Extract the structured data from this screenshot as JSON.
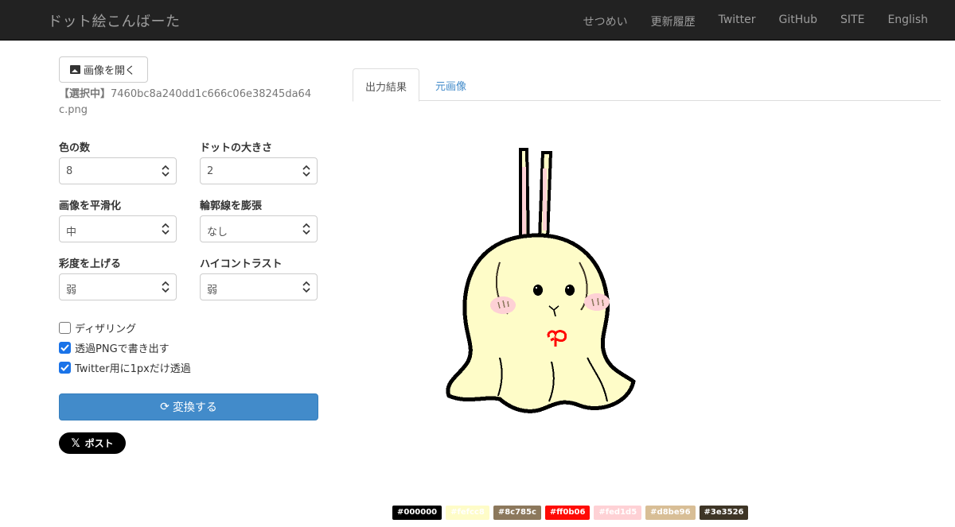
{
  "navbar": {
    "brand": "ドット絵こんばーた",
    "links": [
      "せつめい",
      "更新履歴",
      "Twitter",
      "GitHub",
      "SITE",
      "English"
    ]
  },
  "controls": {
    "open_button": "画像を開く",
    "selected_prefix": "【選択中】",
    "selected_file": "7460bc8a240dd1c666c06e38245da64c.png",
    "fields": [
      {
        "label": "色の数",
        "value": "8"
      },
      {
        "label": "ドットの大きさ",
        "value": "2"
      },
      {
        "label": "画像を平滑化",
        "value": "中"
      },
      {
        "label": "輪郭線を膨張",
        "value": "なし"
      },
      {
        "label": "彩度を上げる",
        "value": "弱"
      },
      {
        "label": "ハイコントラスト",
        "value": "弱"
      }
    ],
    "checkboxes": [
      {
        "label": "ディザリング",
        "checked": false
      },
      {
        "label": "透過PNGで書き出す",
        "checked": true
      },
      {
        "label": "Twitter用に1pxだけ透過",
        "checked": true
      }
    ],
    "convert_button": "変換する",
    "post_button": "ポスト"
  },
  "tabs": [
    "出力結果",
    "元画像"
  ],
  "palette": [
    {
      "hex": "#ffffff",
      "label": ""
    },
    {
      "hex": "#000000",
      "label": "#000000"
    },
    {
      "hex": "#fefcc8",
      "label": "#fefcc8"
    },
    {
      "hex": "#8c785c",
      "label": "#8c785c"
    },
    {
      "hex": "#ff0b06",
      "label": "#ff0b06"
    },
    {
      "hex": "#fed1d5",
      "label": "#fed1d5"
    },
    {
      "hex": "#d8be96",
      "label": "#d8be96"
    },
    {
      "hex": "#3e3526",
      "label": "#3e3526"
    }
  ]
}
